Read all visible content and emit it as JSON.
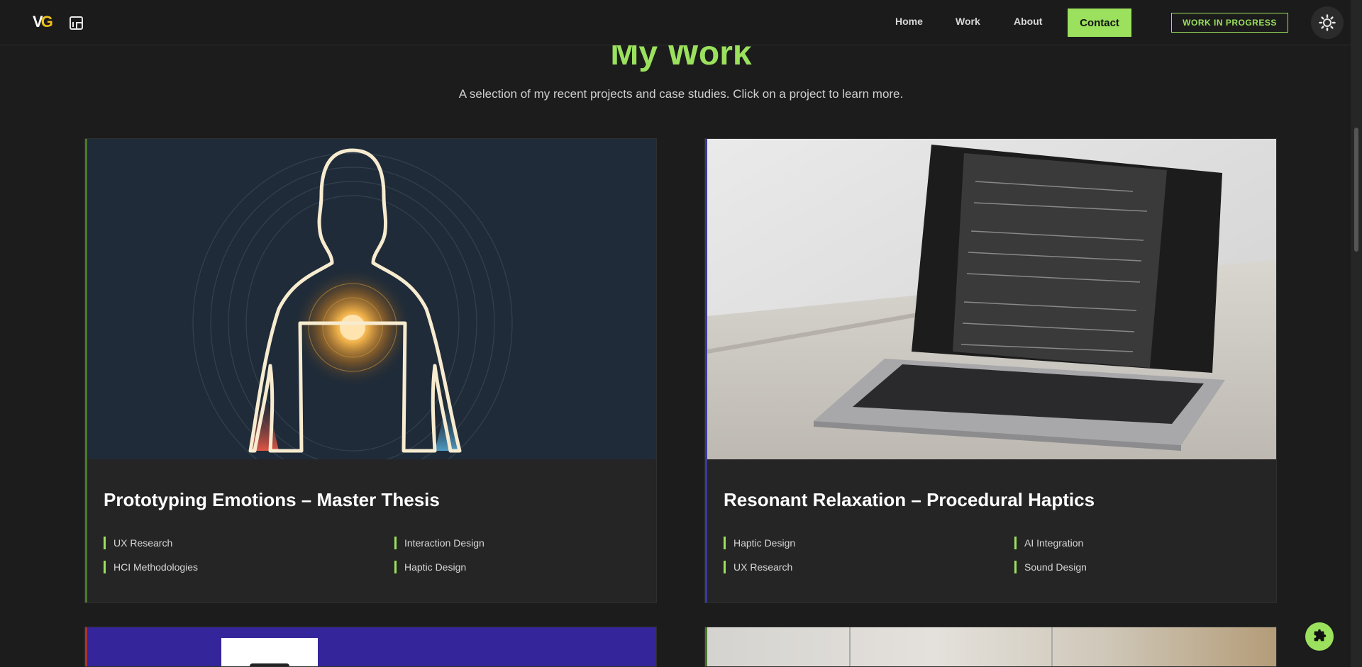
{
  "nav": {
    "logo_text": "VG",
    "links": [
      "Home",
      "Work",
      "About"
    ],
    "contact_label": "Contact",
    "wip_label": "WORK IN PROGRESS"
  },
  "header": {
    "title": "My Work",
    "subtitle": "A selection of my recent projects and case studies. Click on a project to learn more."
  },
  "projects": [
    {
      "title": "Prototyping Emotions – Master Thesis",
      "tags": [
        "UX Research",
        "Interaction Design",
        "HCI Methodologies",
        "Haptic Design"
      ]
    },
    {
      "title": "Resonant Relaxation – Procedural Haptics",
      "tags": [
        "Haptic Design",
        "AI Integration",
        "UX Research",
        "Sound Design"
      ]
    }
  ],
  "colors": {
    "accent": "#9be15d",
    "background": "#1c1c1c",
    "card": "#252525",
    "card1_border": "#4a7a2a",
    "card2_border": "#3a3aa0",
    "card3_border": "#b03030"
  },
  "icons": {
    "linkedin": "linkedin-icon",
    "theme": "sun-icon",
    "fab": "puzzle-icon"
  }
}
